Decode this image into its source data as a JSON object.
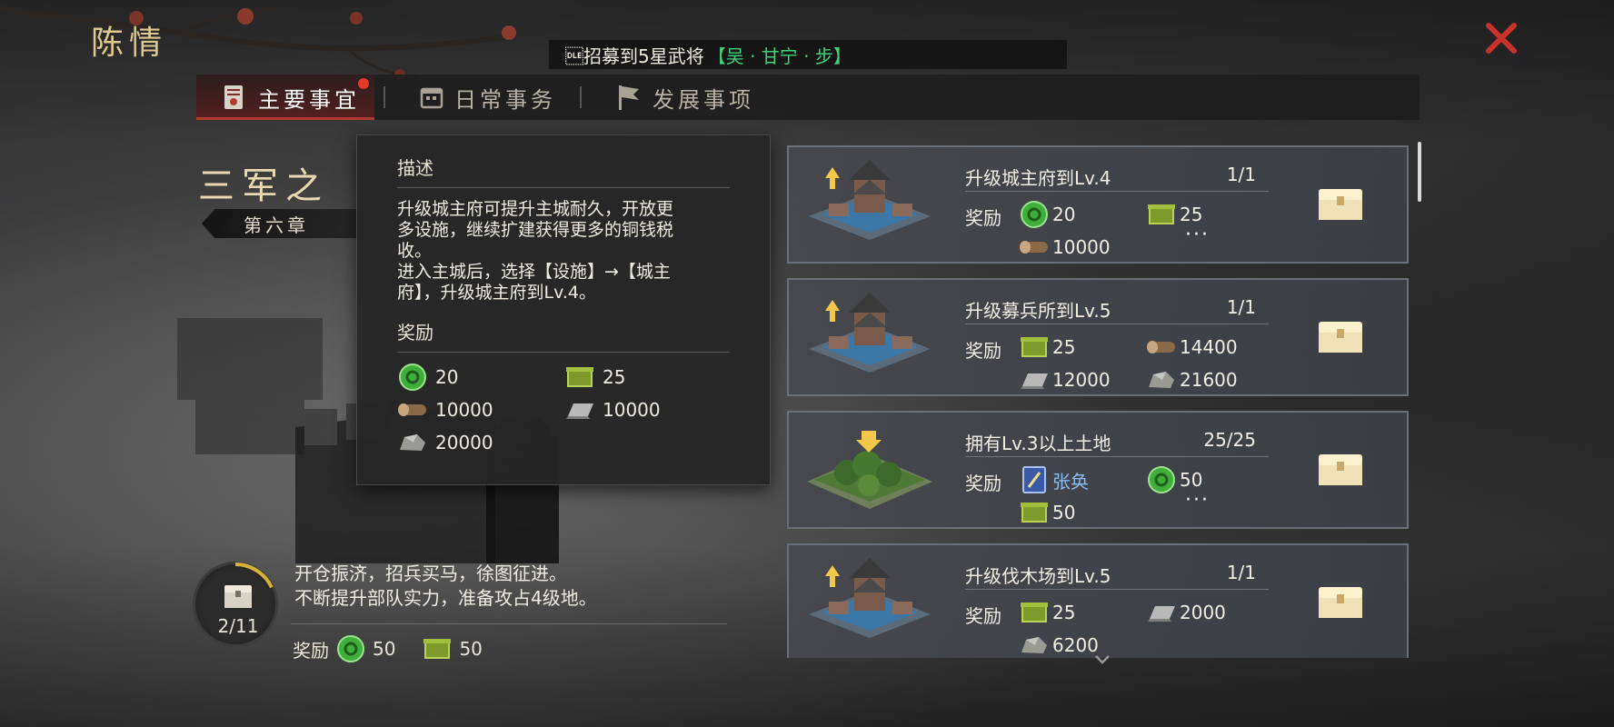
{
  "page": {
    "title": "陈情"
  },
  "notice": {
    "text": "\u0010招募到5星武将",
    "highlight": "【吴 · 甘宁 · 步】"
  },
  "tabs": [
    {
      "label": "主要事宜",
      "icon": "scroll-icon",
      "active": true,
      "badge": true
    },
    {
      "label": "日常事务",
      "icon": "calendar-icon",
      "active": false
    },
    {
      "label": "发展事项",
      "icon": "flag-icon",
      "active": false
    }
  ],
  "chapter": {
    "title": "三军之",
    "subtitle": "第六章"
  },
  "tooltip": {
    "heading": "描述",
    "description_lines": [
      "升级城主府可提升主城耐久，开放更",
      "多设施，继续扩建获得更多的铜钱税",
      "收。",
      "进入主城后，选择【设施】→【城主",
      "府】，升级城主府到Lv.4。"
    ],
    "reward_heading": "奖励",
    "rewards": [
      {
        "icon": "jade-icon",
        "value": "20"
      },
      {
        "icon": "bronze-box-icon",
        "value": "25"
      },
      {
        "icon": "wood-icon",
        "value": "10000"
      },
      {
        "icon": "iron-icon",
        "value": "10000"
      },
      {
        "icon": "stone-icon",
        "value": "20000"
      }
    ]
  },
  "chapter_progress": {
    "count_text": "2/11",
    "progress": 0.18,
    "lines": [
      "开仓振济，招兵买马，徐图征进。",
      "不断提升部队实力，准备攻占4级地。"
    ],
    "reward_label": "奖励",
    "rewards": [
      {
        "icon": "jade-icon",
        "value": "50"
      },
      {
        "icon": "bronze-box-icon",
        "value": "50"
      }
    ]
  },
  "quests": [
    {
      "name": "升级城主府到Lv.4",
      "progress": "1/1",
      "reward_label": "奖励",
      "thumb": "palace-upgrade",
      "rewards": [
        {
          "icon": "jade-icon",
          "value": "20"
        },
        {
          "icon": "bronze-box-icon",
          "value": "25"
        },
        {
          "icon": "wood-icon",
          "value": "10000"
        }
      ],
      "more": "···"
    },
    {
      "name": "升级募兵所到Lv.5",
      "progress": "1/1",
      "reward_label": "奖励",
      "thumb": "palace-upgrade",
      "rewards": [
        {
          "icon": "bronze-box-icon",
          "value": "25"
        },
        {
          "icon": "wood-icon",
          "value": "14400"
        },
        {
          "icon": "iron-icon",
          "value": "12000"
        },
        {
          "icon": "stone-icon",
          "value": "21600"
        }
      ]
    },
    {
      "name": "拥有Lv.3以上土地",
      "progress": "25/25",
      "reward_label": "奖励",
      "thumb": "land-forest",
      "rewards": [
        {
          "icon": "hero-card-icon",
          "value": "张奂"
        },
        {
          "icon": "jade-icon",
          "value": "50"
        },
        {
          "icon": "bronze-box-icon",
          "value": "50"
        }
      ],
      "more": "···"
    },
    {
      "name": "升级伐木场到Lv.5",
      "progress": "1/1",
      "reward_label": "奖励",
      "thumb": "palace-upgrade",
      "rewards": [
        {
          "icon": "bronze-box-icon",
          "value": "25"
        },
        {
          "icon": "iron-icon",
          "value": "2000"
        },
        {
          "icon": "stone-icon",
          "value": "6200"
        }
      ]
    }
  ],
  "colors": {
    "accent_gold": "#e0c98e",
    "highlight_green": "#3fd27a",
    "close_red": "#c8322a",
    "hero_blue": "#8bbcf2"
  }
}
